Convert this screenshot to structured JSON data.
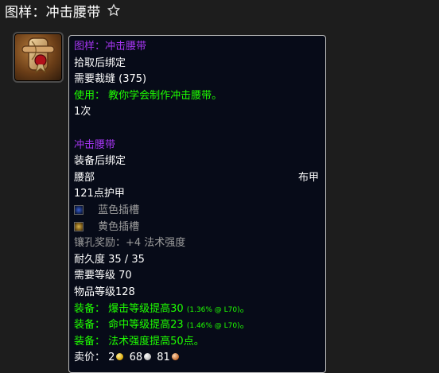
{
  "page": {
    "title": "图样：冲击腰带"
  },
  "tooltip": {
    "recipe_name": "图样：冲击腰带",
    "bind_on_pickup": "拾取后绑定",
    "requires_skill": "需要裁缝 (375)",
    "use_label": "使用：",
    "use_text": "教你学会制作冲击腰带。",
    "charges": "1次",
    "item_name": "冲击腰带",
    "bind_on_equip": "装备后绑定",
    "slot": "腰部",
    "armor_type": "布甲",
    "armor": "121点护甲",
    "socket_blue": "蓝色插槽",
    "socket_yellow": "黄色插槽",
    "socket_bonus": "镶孔奖励：+4 法术强度",
    "durability": "耐久度 35 / 35",
    "required_level": "需要等级 70",
    "item_level": "物品等级128",
    "equip_label": "装备：",
    "equip_1_text": "爆击等级提高30",
    "equip_1_detail": "(1.36% @ L70)",
    "equip_2_text": "命中等级提高23",
    "equip_2_detail": "(1.46% @ L70)",
    "equip_3_text": "法术强度提高50点。",
    "sell_label": "卖价：",
    "sell_gold": "2",
    "sell_silver": "68",
    "sell_copper": "81",
    "period": "。"
  },
  "icons": {
    "favorite": "star-outline-icon",
    "item": "recipe-scroll-icon",
    "socket_blue": "blue-socket-icon",
    "socket_yellow": "yellow-socket-icon",
    "gold": "gold-coin-icon",
    "silver": "silver-coin-icon",
    "copper": "copper-coin-icon"
  },
  "colors": {
    "epic": "#a335ee",
    "green": "#1eff00",
    "gray": "#9d9d9d",
    "tooltip_bg": "#070b18"
  }
}
